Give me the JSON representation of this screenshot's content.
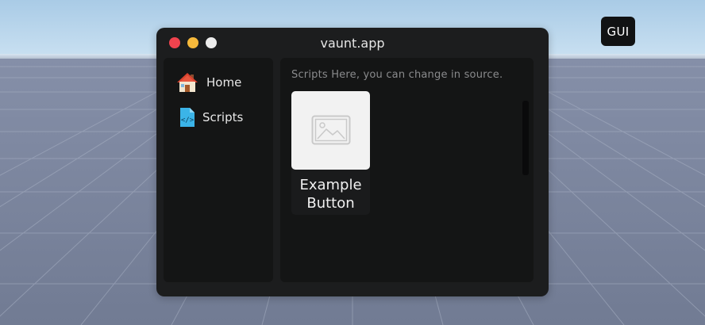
{
  "window": {
    "title": "vaunt.app",
    "traffic_lights": {
      "close_color": "#f0434e",
      "minimize_color": "#f6b93b",
      "maximize_color": "#ececec"
    }
  },
  "gui_toggle": {
    "label": "GUI"
  },
  "sidebar": {
    "items": [
      {
        "label": "Home",
        "icon": "house-icon"
      },
      {
        "label": "Scripts",
        "icon": "code-file-icon"
      }
    ]
  },
  "content": {
    "hint": "Scripts Here, you can change in source.",
    "cards": [
      {
        "label_line1": "Example",
        "label_line2": "Button",
        "icon": "image-placeholder-icon"
      }
    ]
  }
}
